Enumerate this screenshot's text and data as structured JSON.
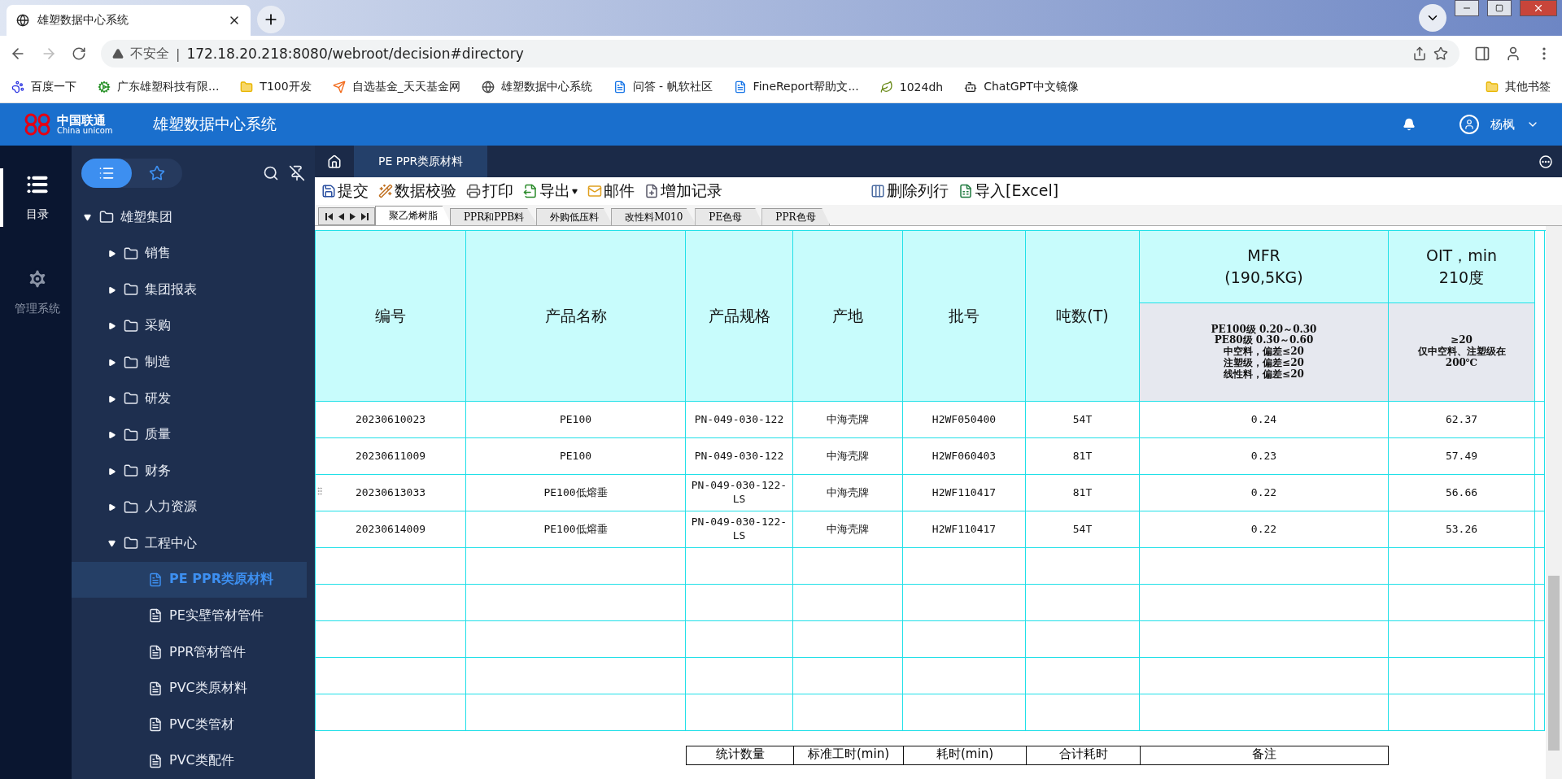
{
  "browser": {
    "tab_title": "雄塑数据中心系统",
    "security": "不安全",
    "separator": "|",
    "url": "172.18.20.218:8080/webroot/decision#directory",
    "bookmarks": [
      {
        "label": "百度一下",
        "kind": "paw"
      },
      {
        "label": "广东雄塑科技有限...",
        "kind": "gear"
      },
      {
        "label": "T100开发",
        "kind": "folder"
      },
      {
        "label": "自选基金_天天基金网",
        "kind": "plane"
      },
      {
        "label": "雄塑数据中心系统",
        "kind": "globe"
      },
      {
        "label": "问答 - 帆软社区",
        "kind": "f"
      },
      {
        "label": "FineReport帮助文...",
        "kind": "f"
      },
      {
        "label": "1024dh",
        "kind": "leaf"
      },
      {
        "label": "ChatGPT中文镜像",
        "kind": "spiral"
      }
    ],
    "other_bookmarks": "其他书签"
  },
  "app": {
    "logo_cn": "中国联通",
    "logo_en": "China unicom",
    "title": "雄塑数据中心系统",
    "user": "杨枫"
  },
  "rail": [
    {
      "label": "目录",
      "kind": "catalog",
      "selected": true
    },
    {
      "label": "管理系统",
      "kind": "gear",
      "selected": false
    }
  ],
  "sidebar": {
    "toggles": [
      {
        "kind": "list",
        "selected": true
      },
      {
        "kind": "star",
        "selected": false
      }
    ],
    "tree": [
      {
        "label": "雄塑集团",
        "kind": "folder",
        "expanded": true,
        "children": [
          {
            "label": "销售",
            "kind": "folder",
            "expanded": false
          },
          {
            "label": "集团报表",
            "kind": "folder",
            "expanded": false
          },
          {
            "label": "采购",
            "kind": "folder",
            "expanded": false
          },
          {
            "label": "制造",
            "kind": "folder",
            "expanded": false
          },
          {
            "label": "研发",
            "kind": "folder",
            "expanded": false
          },
          {
            "label": "质量",
            "kind": "folder",
            "expanded": false
          },
          {
            "label": "财务",
            "kind": "folder",
            "expanded": false
          },
          {
            "label": "人力资源",
            "kind": "folder",
            "expanded": false
          },
          {
            "label": "工程中心",
            "kind": "folder",
            "expanded": true,
            "children": [
              {
                "label": "PE PPR类原材料",
                "kind": "report",
                "selected": true
              },
              {
                "label": "PE实壁管材管件",
                "kind": "report",
                "selected": false
              },
              {
                "label": "PPR管材管件",
                "kind": "report",
                "selected": false
              },
              {
                "label": "PVC类原材料",
                "kind": "report",
                "selected": false
              },
              {
                "label": "PVC类管材",
                "kind": "report",
                "selected": false
              },
              {
                "label": "PVC类配件",
                "kind": "report",
                "selected": false
              }
            ]
          }
        ]
      }
    ]
  },
  "content_tabs": [
    {
      "label": "PE PPR类原材料",
      "selected": true
    }
  ],
  "toolbar": {
    "left": [
      {
        "label": "提交",
        "kind": "save"
      },
      {
        "label": "数据校验",
        "kind": "check"
      },
      {
        "label": "打印",
        "kind": "print"
      },
      {
        "label": "导出",
        "kind": "export",
        "dropdown": true
      },
      {
        "label": "邮件",
        "kind": "mail"
      },
      {
        "label": "增加记录",
        "kind": "add"
      }
    ],
    "right": [
      {
        "label": "删除列行",
        "kind": "delete"
      },
      {
        "label": "导入[Excel]",
        "kind": "excel"
      }
    ]
  },
  "sheet_tabs": [
    {
      "label": "聚乙烯树脂",
      "selected": true
    },
    {
      "label": "PPR和PPB料",
      "selected": false
    },
    {
      "label": "外购低压料",
      "selected": false
    },
    {
      "label": "改性料M010",
      "selected": false
    },
    {
      "label": "PE色母",
      "selected": false
    },
    {
      "label": "PPR色母",
      "selected": false
    }
  ],
  "table": {
    "columns": [
      "编号",
      "产品名称",
      "产品规格",
      "产地",
      "批号",
      "吨数(T)"
    ],
    "group_columns": [
      {
        "title": [
          "MFR",
          "(190,5KG)"
        ],
        "spec": [
          "PE100级 0.20～0.30",
          "PE80级 0.30～0.60",
          "中空料，偏差≤20",
          "注塑级，偏差≤20",
          "线性料，偏差≤20"
        ]
      },
      {
        "title": [
          "OIT，min",
          "210度"
        ],
        "spec": [
          "≥20",
          "仅中空料、注塑级在",
          "200℃"
        ]
      }
    ],
    "rows": [
      {
        "cells": [
          "20230610023",
          "PE100",
          "PN-049-030-122",
          "中海壳牌",
          "H2WF050400",
          "54T",
          "0.24",
          "62.37"
        ],
        "drag_handle": false
      },
      {
        "cells": [
          "20230611009",
          "PE100",
          "PN-049-030-122",
          "中海壳牌",
          "H2WF060403",
          "81T",
          "0.23",
          "57.49"
        ],
        "drag_handle": false
      },
      {
        "cells": [
          "20230613033",
          "PE100低熔垂",
          "PN-049-030-122-LS",
          "中海壳牌",
          "H2WF110417",
          "81T",
          "0.22",
          "56.66"
        ],
        "drag_handle": true
      },
      {
        "cells": [
          "20230614009",
          "PE100低熔垂",
          "PN-049-030-122-LS",
          "中海壳牌",
          "H2WF110417",
          "54T",
          "0.22",
          "53.26"
        ],
        "drag_handle": false
      }
    ]
  },
  "summary_table": {
    "columns": [
      "统计数量",
      "标准工时(min)",
      "耗时(min)",
      "合计耗时",
      "备注"
    ]
  }
}
